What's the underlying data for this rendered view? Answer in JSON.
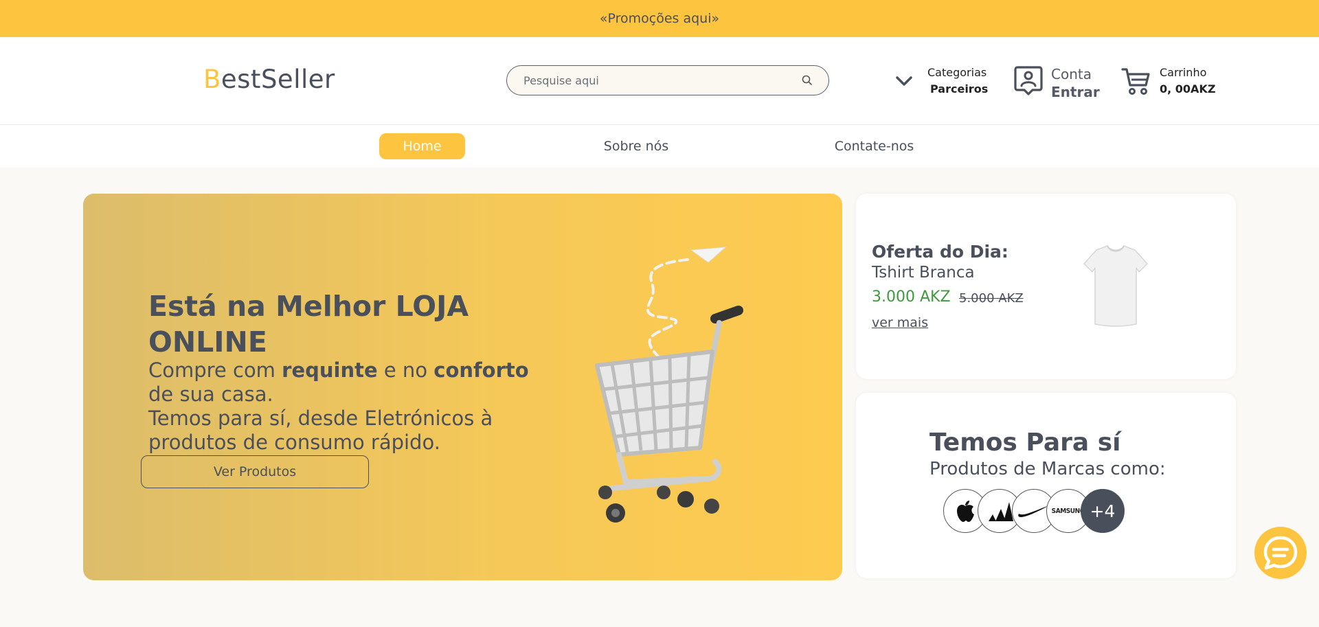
{
  "promo": {
    "text": "«Promoções aqui»"
  },
  "header": {
    "logo_first": "B",
    "logo_rest": "estSeller",
    "search": {
      "placeholder": "Pesquise aqui"
    },
    "categories": {
      "line1": "Categorias",
      "line2": "Parceiros"
    },
    "account": {
      "line1": "Conta",
      "line2": "Entrar"
    },
    "cart": {
      "line1": "Carrinho",
      "line2": "0, 00AKZ"
    }
  },
  "nav": {
    "items": [
      {
        "label": "Home"
      },
      {
        "label": "Sobre nós"
      },
      {
        "label": "Contate-nos"
      }
    ]
  },
  "hero": {
    "title": "Está na Melhor LOJA ONLINE",
    "sub_part1": "Compre com ",
    "sub_bold1": "requinte",
    "sub_part2": " e no ",
    "sub_bold2": "conforto",
    "sub_part3": " de sua casa.",
    "sub_line2": "Temos para sí, desde Eletrónicos à produtos de consumo rápido.",
    "button": "Ver Produtos"
  },
  "offer": {
    "label": "Oferta do Dia:",
    "product": "Tshirt Branca",
    "price": "3.000 AKZ",
    "old_price": "5.000 AKZ",
    "link": "ver mais"
  },
  "brands": {
    "title": "Temos Para sí",
    "subtitle": "Produtos de Marcas como:",
    "logos": [
      "apple",
      "adidas",
      "nike",
      "SAMSUNG"
    ],
    "more": "+4"
  },
  "colors": {
    "accent": "#fdc43f",
    "text": "#4a4f5c",
    "price_green": "#3e9a3c"
  },
  "icons": [
    "search-icon",
    "chevron-down-icon",
    "account-icon",
    "cart-icon",
    "chat-icon"
  ]
}
